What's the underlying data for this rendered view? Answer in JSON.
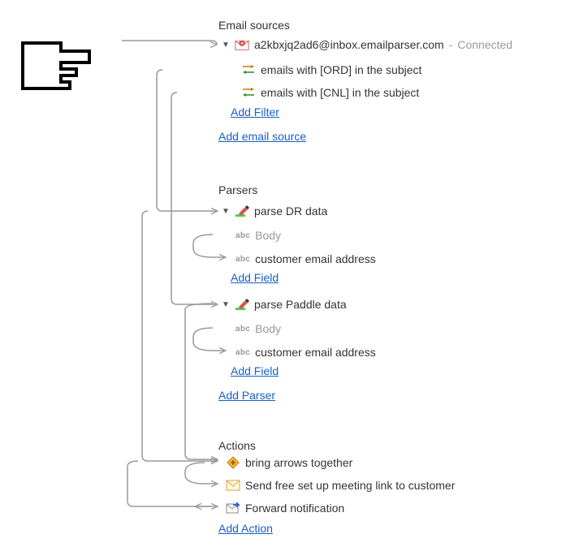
{
  "sections": {
    "email_sources": {
      "title": "Email sources",
      "source": {
        "address": "a2kbxjq2ad6@inbox.emailparser.com",
        "status": "Connected",
        "filters": [
          "emails with [ORD] in the subject",
          "emails with [CNL] in the subject"
        ]
      },
      "add_filter": "Add Filter",
      "add_source": "Add email source"
    },
    "parsers": {
      "title": "Parsers",
      "items": [
        {
          "name": "parse DR data",
          "fields": [
            "Body",
            "customer email address"
          ]
        },
        {
          "name": "parse Paddle data",
          "fields": [
            "Body",
            "customer email address"
          ]
        }
      ],
      "add_field": "Add Field",
      "add_parser": "Add Parser"
    },
    "actions": {
      "title": "Actions",
      "items": [
        "bring arrows together",
        "Send free set up meeting link to customer",
        "Forward notification"
      ],
      "add_action": "Add Action"
    }
  }
}
